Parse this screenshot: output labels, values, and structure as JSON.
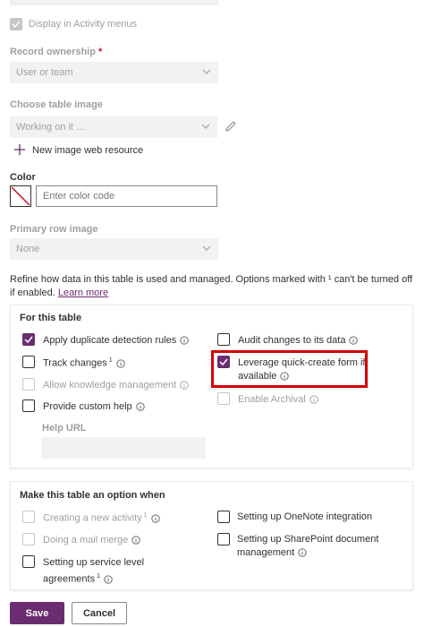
{
  "display_activity": {
    "label": "Display in Activity menus",
    "checked": true,
    "disabled": true
  },
  "record_ownership": {
    "label": "Record ownership",
    "required_mark": "*",
    "value": "User or team"
  },
  "table_image": {
    "label": "Choose table image",
    "value": "Working on it ...",
    "new_resource_label": "New image web resource"
  },
  "color": {
    "label": "Color",
    "placeholder": "Enter color code"
  },
  "primary_row_image": {
    "label": "Primary row image",
    "value": "None"
  },
  "description": {
    "text": "Refine how data in this table is used and managed. Options marked with ¹ can't be turned off if enabled.",
    "link": "Learn more"
  },
  "for_this_table": {
    "title": "For this table",
    "left": [
      {
        "label": "Apply duplicate detection rules",
        "checked": true,
        "disabled": false
      },
      {
        "label": "Track changes",
        "sup": "1",
        "checked": false,
        "disabled": false
      },
      {
        "label": "Allow knowledge management",
        "checked": false,
        "disabled": true
      },
      {
        "label": "Provide custom help",
        "checked": false,
        "disabled": false
      }
    ],
    "right": [
      {
        "label": "Audit changes to its data",
        "checked": false,
        "disabled": false
      },
      {
        "label": "Leverage quick-create form if available",
        "line1": "Leverage quick-create form if",
        "line2": "available",
        "checked": true,
        "disabled": false
      },
      {
        "label": "Enable Archival",
        "checked": false,
        "disabled": true
      }
    ],
    "help_url_label": "Help URL"
  },
  "option_when": {
    "title": "Make this table an option when",
    "left": [
      {
        "label": "Creating a new activity",
        "sup": "1",
        "disabled": true
      },
      {
        "label": "Doing a mail merge",
        "disabled": true
      },
      {
        "label": "Setting up service level agreements",
        "line1": "Setting up service level",
        "line2": "agreements",
        "sup": "1",
        "disabled": false
      }
    ],
    "right": [
      {
        "label": "Setting up OneNote integration",
        "disabled": false
      },
      {
        "label": "Setting up SharePoint document management",
        "line1": "Setting up SharePoint document",
        "line2": "management",
        "disabled": false
      }
    ]
  },
  "footer": {
    "save": "Save",
    "cancel": "Cancel"
  },
  "colors": {
    "accent": "#6b2d6f",
    "highlight": "#d30000",
    "disabled_text": "#a19f9d"
  }
}
